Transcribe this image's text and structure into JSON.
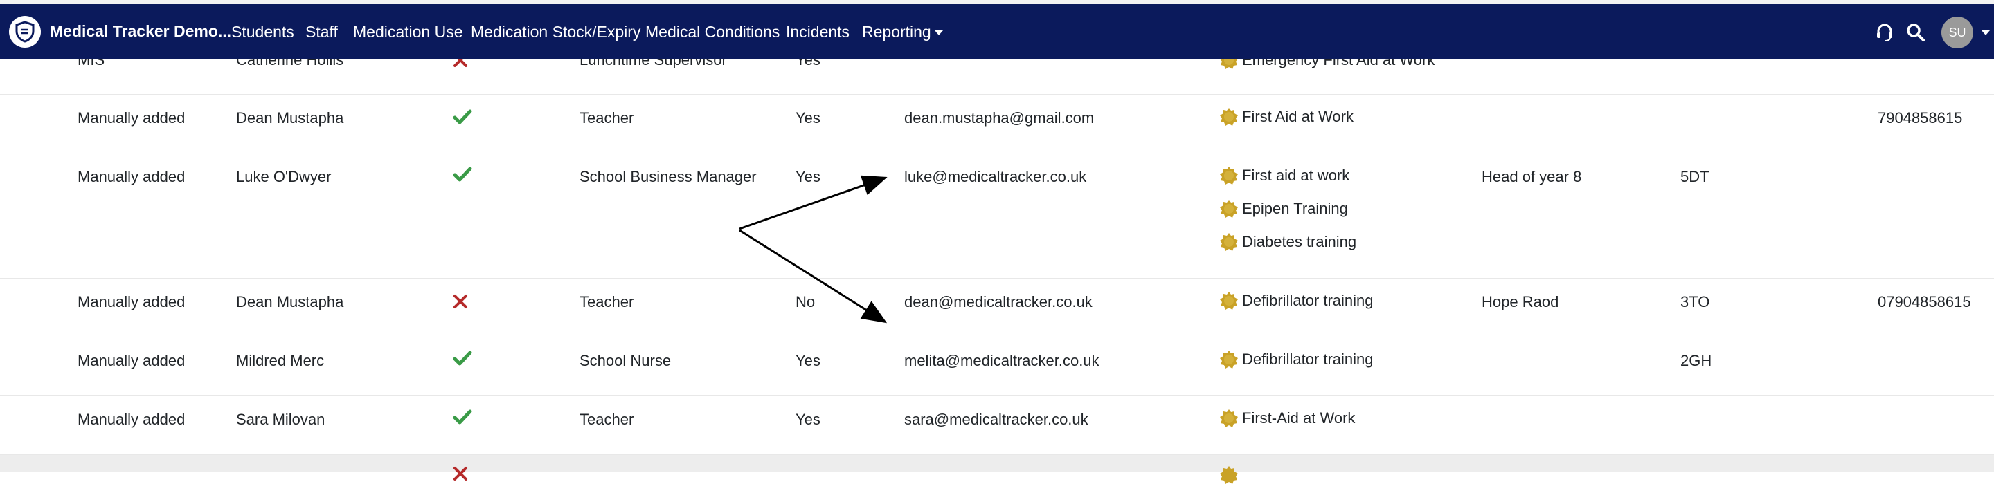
{
  "nav": {
    "brand": "Medical Tracker Demo...",
    "items": [
      "Students",
      "Staff",
      "Medication Use",
      "Medication Stock/Expiry",
      "Medical Conditions",
      "Incidents"
    ],
    "reporting": "Reporting",
    "avatar": "SU"
  },
  "rows": [
    {
      "source": "MIS",
      "name": "Catherine Hollis",
      "active": false,
      "role": "Lunchtime Supervisor",
      "flag": "Yes",
      "email": "",
      "certs": [
        "Emergency First Aid at Work"
      ],
      "dept": "",
      "form": "",
      "phone": ""
    },
    {
      "source": "Manually added",
      "name": "Dean Mustapha",
      "active": true,
      "role": "Teacher",
      "flag": "Yes",
      "email": "dean.mustapha@gmail.com",
      "certs": [
        "First Aid at Work"
      ],
      "dept": "",
      "form": "",
      "phone": "7904858615"
    },
    {
      "source": "Manually added",
      "name": "Luke O'Dwyer",
      "active": true,
      "role": "School Business Manager",
      "flag": "Yes",
      "email": "luke@medicaltracker.co.uk",
      "certs": [
        "First aid at work",
        "Epipen Training",
        "Diabetes training"
      ],
      "dept": "Head of year 8",
      "form": "5DT",
      "phone": ""
    },
    {
      "source": "Manually added",
      "name": "Dean Mustapha",
      "active": false,
      "role": "Teacher",
      "flag": "No",
      "email": "dean@medicaltracker.co.uk",
      "certs": [
        "Defibrillator training"
      ],
      "dept": "Hope Raod",
      "form": "3TO",
      "phone": "07904858615"
    },
    {
      "source": "Manually added",
      "name": "Mildred Merc",
      "active": true,
      "role": "School Nurse",
      "flag": "Yes",
      "email": "melita@medicaltracker.co.uk",
      "certs": [
        "Defibrillator training"
      ],
      "dept": "",
      "form": "2GH",
      "phone": ""
    },
    {
      "source": "Manually added",
      "name": "Sara Milovan",
      "active": true,
      "role": "Teacher",
      "flag": "Yes",
      "email": "sara@medicaltracker.co.uk",
      "certs": [
        "First-Aid at Work"
      ],
      "dept": "",
      "form": "",
      "phone": ""
    }
  ],
  "colors": {
    "navbar": "#0b1a5c",
    "check": "#3a9b47",
    "cross": "#b52a2a",
    "badge": "#c9a227"
  }
}
